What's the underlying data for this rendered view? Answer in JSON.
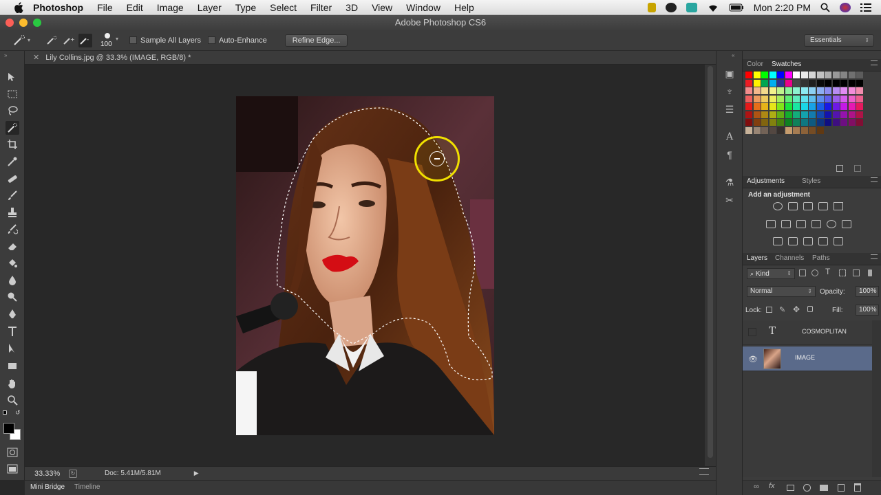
{
  "menubar": {
    "app_name": "Photoshop",
    "items": [
      "File",
      "Edit",
      "Image",
      "Layer",
      "Type",
      "Select",
      "Filter",
      "3D",
      "View",
      "Window",
      "Help"
    ],
    "clock": "Mon 2:20 PM"
  },
  "window": {
    "title": "Adobe Photoshop CS6"
  },
  "options": {
    "brush_size": "100",
    "sample_all_layers": "Sample All Layers",
    "auto_enhance": "Auto-Enhance",
    "refine_edge": "Refine Edge...",
    "workspace": "Essentials"
  },
  "document": {
    "tab_title": "Lily Collins.jpg @ 33.3% (IMAGE, RGB/8) *"
  },
  "status": {
    "zoom": "33.33%",
    "doc_size": "Doc: 5.41M/5.81M"
  },
  "bottom_tabs": [
    "Mini Bridge",
    "Timeline"
  ],
  "color_panel": {
    "tabs": [
      "Color",
      "Swatches"
    ]
  },
  "adjustments_panel": {
    "tabs": [
      "Adjustments",
      "Styles"
    ],
    "heading": "Add an adjustment"
  },
  "layers_panel": {
    "tabs": [
      "Layers",
      "Channels",
      "Paths"
    ],
    "kind": "Kind",
    "blend_mode": "Normal",
    "opacity_label": "Opacity:",
    "opacity": "100%",
    "lock_label": "Lock:",
    "fill_label": "Fill:",
    "fill": "100%",
    "layers": [
      {
        "name": "COSMOPLITAN",
        "type": "text",
        "visible": false
      },
      {
        "name": "IMAGE",
        "type": "image",
        "visible": true,
        "selected": true
      }
    ]
  }
}
